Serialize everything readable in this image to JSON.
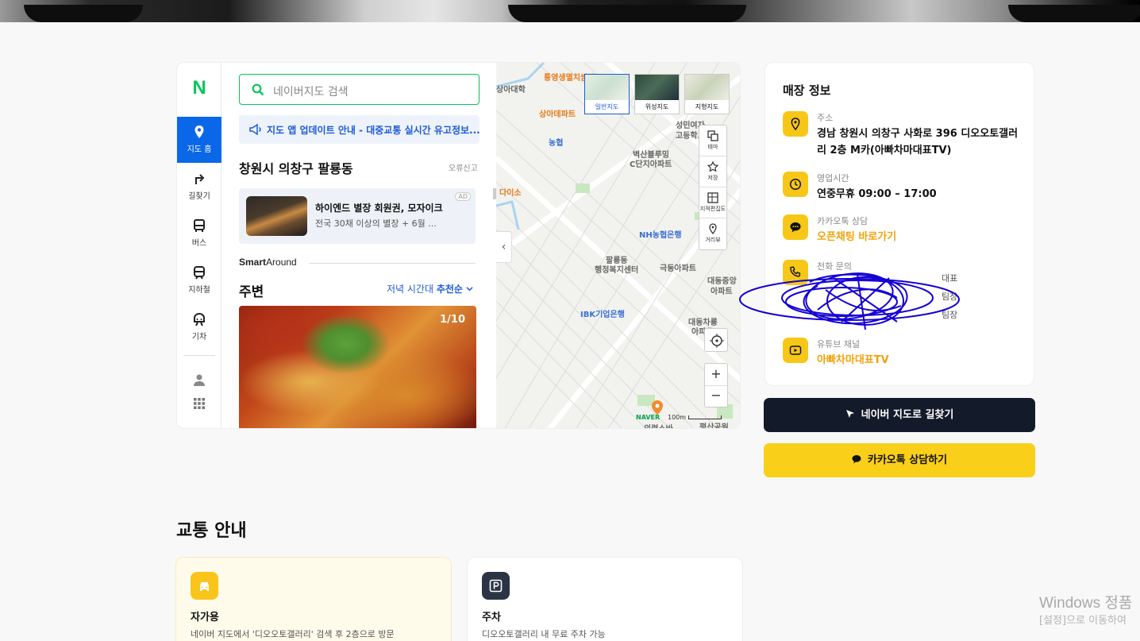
{
  "map_widget": {
    "logo": "N",
    "nav": [
      {
        "label": "지도 홈",
        "icon": "location-pin-icon"
      },
      {
        "label": "길찾기",
        "icon": "turn-arrow-icon"
      },
      {
        "label": "버스",
        "icon": "bus-icon"
      },
      {
        "label": "지하철",
        "icon": "subway-icon"
      },
      {
        "label": "기차",
        "icon": "train-icon"
      }
    ],
    "search_placeholder": "네이버지도 검색",
    "notice": "지도 앱 업데이트 안내 - 대중교통 실시간 유고정보...",
    "area_title": "창원시 의창구 팔룡동",
    "report_link": "오류신고",
    "ad": {
      "title": "하이엔드 별장 회원권, 모자이크",
      "desc": "전국 30채 이상의 별장 + 6월 ...",
      "badge": "AD"
    },
    "smart_around": {
      "bold": "Smart",
      "rest": "Around"
    },
    "nearby": {
      "title": "주변",
      "filter_prefix": "저녁 시간대",
      "filter_value": "추천순",
      "photo_count": "1/10"
    },
    "map_types": [
      "일반지도",
      "위성지도",
      "지형지도"
    ],
    "map_controls": [
      "테마",
      "저장",
      "지적편집도",
      "거리뷰"
    ],
    "map_labels": [
      {
        "text": "통영생멸치쌈밥",
        "cls": "orange"
      },
      {
        "text": "상아대학",
        "cls": ""
      },
      {
        "text": "상아데파트",
        "cls": "orange"
      },
      {
        "text": "농협",
        "cls": "blue"
      },
      {
        "text": "벽산블루밍",
        "cls": ""
      },
      {
        "text": "C단지아파트",
        "cls": ""
      },
      {
        "text": "성민여자",
        "cls": ""
      },
      {
        "text": "고등학교",
        "cls": ""
      },
      {
        "text": "다이소",
        "cls": "orange"
      },
      {
        "text": "NH농협은행",
        "cls": "blue"
      },
      {
        "text": "팔룡동",
        "cls": ""
      },
      {
        "text": "행정복지센터",
        "cls": ""
      },
      {
        "text": "극동아파트",
        "cls": ""
      },
      {
        "text": "대동중앙",
        "cls": ""
      },
      {
        "text": "아파트",
        "cls": ""
      },
      {
        "text": "IBK기업은행",
        "cls": "blue"
      },
      {
        "text": "대동차룡",
        "cls": ""
      },
      {
        "text": "아파트",
        "cls": ""
      },
      {
        "text": "의령소바",
        "cls": ""
      },
      {
        "text": "평산공원",
        "cls": ""
      }
    ],
    "scale_text": "100m",
    "naver_wm": "NAVER"
  },
  "store_info": {
    "title": "매장 정보",
    "address_label": "주소",
    "address": "경남 창원시 의창구 사화로 396 디오오토갤러리 2층 M카(아빠차마대표TV)",
    "hours_label": "영업시간",
    "hours": "연중무휴 09:00 – 17:00",
    "kakao_label": "카카오톡 상담",
    "kakao_link": "오픈채팅 바로가기",
    "phone_label": "전화 문의",
    "phone_lines": [
      "대표",
      "팀장",
      "팀장"
    ],
    "youtube_label": "유튜브 채널",
    "youtube_link": "아빠차마대표TV"
  },
  "buttons": {
    "naver_route": "네이버 지도로 길찾기",
    "kakao_consult": "카카오톡 상담하기"
  },
  "transport": {
    "title": "교통 안내",
    "cards": [
      {
        "title": "자가용",
        "desc": "네이버 지도에서 '디오오토갤러리' 검색 후 2층으로 방문",
        "icon": "car-icon"
      },
      {
        "title": "주차",
        "desc": "디오오토갤러리 내 무료 주차 가능",
        "icon": "parking-icon"
      }
    ]
  },
  "windows_watermark": {
    "line1": "Windows 정품",
    "line2": "[설정]으로 이동하여"
  },
  "colors": {
    "naver_green": "#03c75a",
    "naver_blue": "#0a67e8",
    "accent_yellow": "#f9cf19",
    "dark_button": "#131a2a"
  }
}
